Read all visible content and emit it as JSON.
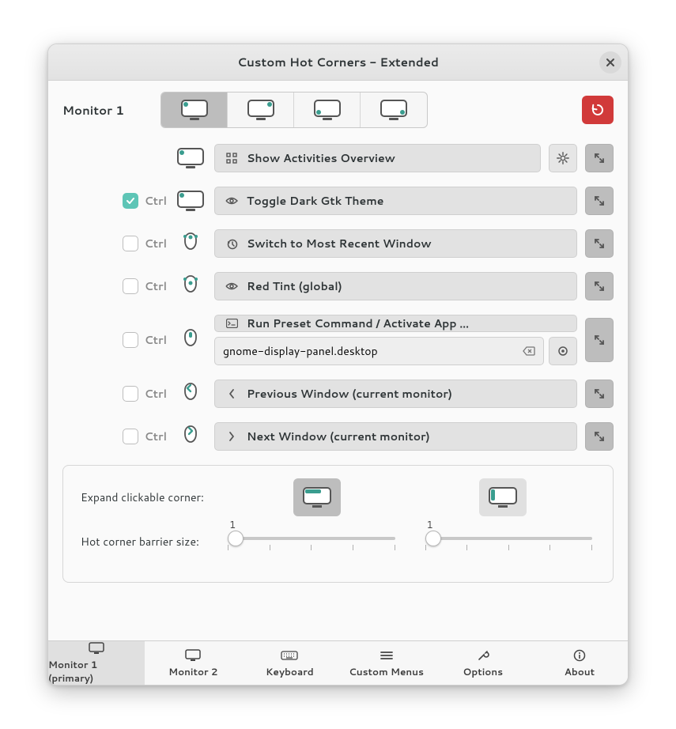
{
  "window": {
    "title": "Custom Hot Corners - Extended"
  },
  "monitor_label": "Monitor 1",
  "ctrl": "Ctrl",
  "corner_tabs_active": 0,
  "actions": [
    {
      "label": "Show Activities Overview",
      "icon": "apps-grid-icon",
      "ctrl": null,
      "gesture": "monitor-tl",
      "gear": true
    },
    {
      "label": "Toggle Dark Gtk Theme",
      "icon": "eye-icon",
      "ctrl": true,
      "gesture": "monitor-tl"
    },
    {
      "label": "Switch to Most Recent Window",
      "icon": "history-icon",
      "ctrl": false,
      "gesture": "scroll-up"
    },
    {
      "label": "Red Tint (global)",
      "icon": "eye-icon",
      "ctrl": false,
      "gesture": "scroll-down"
    },
    {
      "label": "Run Preset Command / Activate App ...",
      "icon": "terminal-icon",
      "ctrl": false,
      "gesture": "click-middle",
      "input": "gnome-display-panel.desktop"
    },
    {
      "label": "Previous Window (current monitor)",
      "icon": "chevron-left-icon",
      "ctrl": false,
      "gesture": "scroll-left"
    },
    {
      "label": "Next Window (current monitor)",
      "icon": "chevron-right-icon",
      "ctrl": false,
      "gesture": "scroll-right"
    }
  ],
  "panel": {
    "expand_label": "Expand clickable corner:",
    "barrier_label": "Hot corner barrier size:",
    "slider1": 1,
    "slider2": 1
  },
  "bottom_tabs": [
    {
      "label": "Monitor 1 (primary)",
      "icon": "monitor-icon",
      "active": true
    },
    {
      "label": "Monitor 2",
      "icon": "monitor-icon"
    },
    {
      "label": "Keyboard",
      "icon": "keyboard-icon"
    },
    {
      "label": "Custom Menus",
      "icon": "menu-icon"
    },
    {
      "label": "Options",
      "icon": "wrench-icon"
    },
    {
      "label": "About",
      "icon": "info-icon"
    }
  ]
}
